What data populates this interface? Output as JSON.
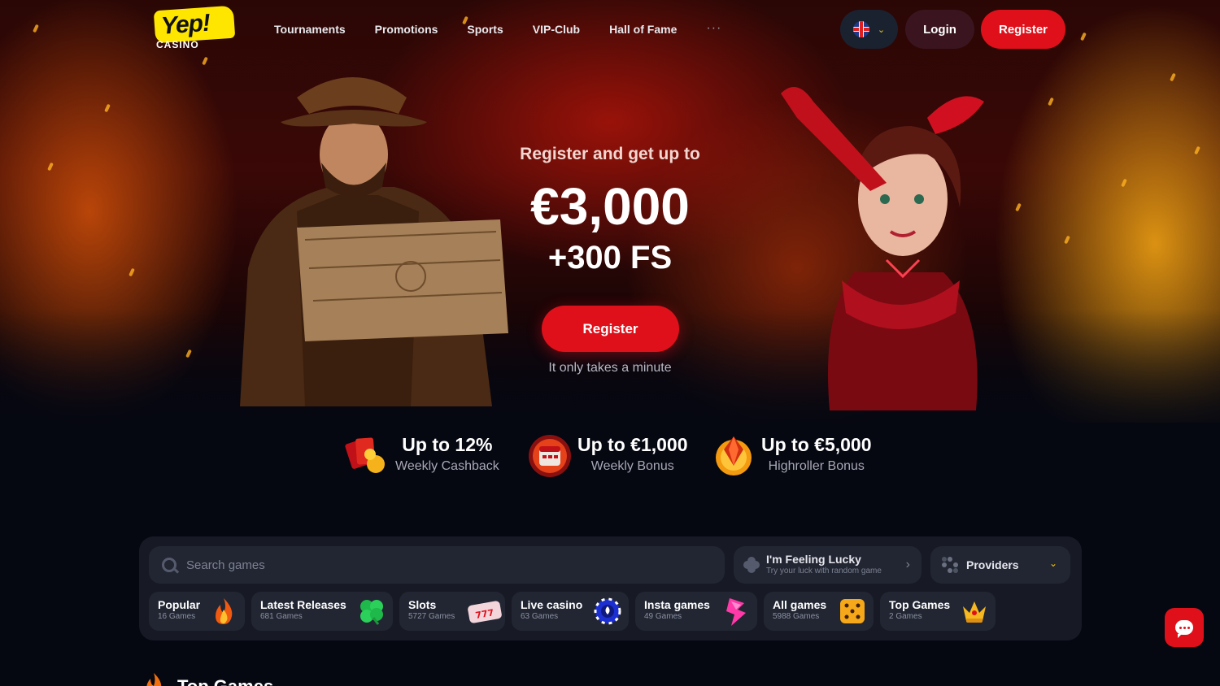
{
  "header": {
    "logo_text": "Yep!",
    "logo_sub": "CASINO",
    "nav": [
      "Tournaments",
      "Promotions",
      "Sports",
      "VIP-Club",
      "Hall of Fame"
    ],
    "more": "···",
    "language_icon": "uk-flag-icon",
    "login_label": "Login",
    "register_label": "Register"
  },
  "hero": {
    "subtitle": "Register and get up to",
    "amount": "€3,000",
    "free_spins": "+300 FS",
    "cta_label": "Register",
    "note": "It only takes a minute"
  },
  "bonuses": [
    {
      "title": "Up to 12%",
      "subtitle": "Weekly Cashback",
      "icon": "cards-icon"
    },
    {
      "title": "Up to €1,000",
      "subtitle": "Weekly Bonus",
      "icon": "calendar-icon"
    },
    {
      "title": "Up to €5,000",
      "subtitle": "Highroller Bonus",
      "icon": "diamond-icon"
    }
  ],
  "games": {
    "search_placeholder": "Search games",
    "lucky_title": "I'm Feeling Lucky",
    "lucky_sub": "Try your luck with random game",
    "providers_label": "Providers",
    "categories": [
      {
        "label": "Popular",
        "count": "16 Games",
        "icon": "flame-icon"
      },
      {
        "label": "Latest Releases",
        "count": "681 Games",
        "icon": "clover-icon"
      },
      {
        "label": "Slots",
        "count": "5727 Games",
        "icon": "slot-machine-icon"
      },
      {
        "label": "Live casino",
        "count": "63 Games",
        "icon": "poker-chip-icon"
      },
      {
        "label": "Insta games",
        "count": "49 Games",
        "icon": "lightning-icon"
      },
      {
        "label": "All games",
        "count": "5988 Games",
        "icon": "dice-icon"
      },
      {
        "label": "Top Games",
        "count": "2 Games",
        "icon": "crown-icon"
      }
    ]
  },
  "section": {
    "title": "Top Games"
  },
  "colors": {
    "accent_red": "#e0101a",
    "brand_yellow": "#ffe600",
    "panel_bg": "#171a25",
    "page_bg": "#050711"
  }
}
